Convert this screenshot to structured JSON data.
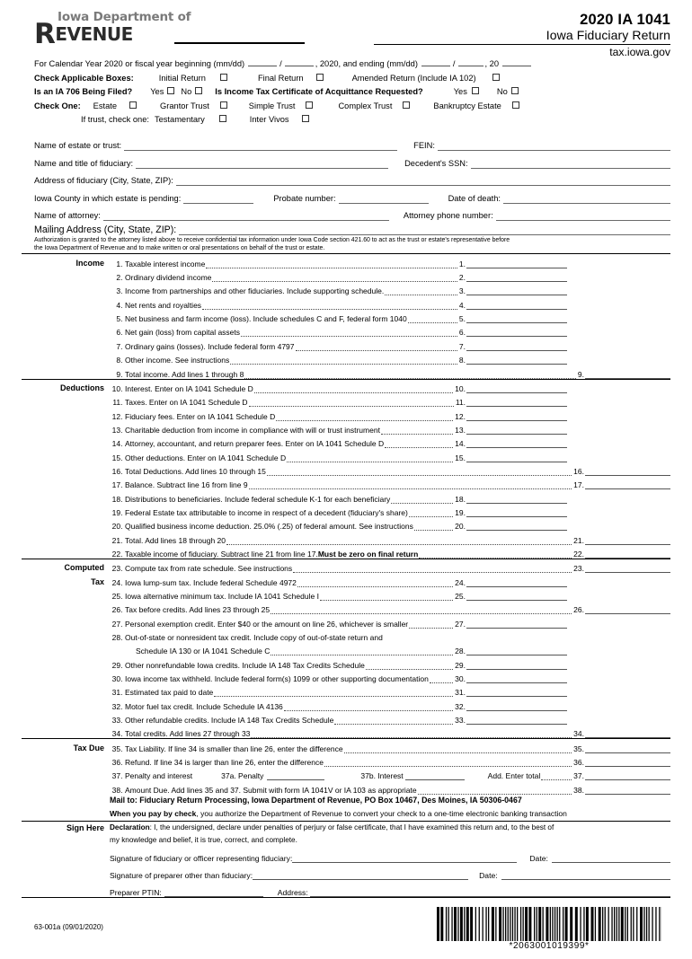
{
  "header": {
    "logo_top": "Iowa Department of",
    "logo_main_drop": "R",
    "logo_main_rest": "EVENUE",
    "title": "2020 IA 1041",
    "subtitle": "Iowa Fiduciary Return",
    "website": "tax.iowa.gov"
  },
  "top": {
    "calendar_year_pre": "For Calendar Year 2020 or fiscal year beginning (mm/dd)",
    "calendar_slash": "/",
    "calendar_mid": ", 2020, and ending (mm/dd)",
    "calendar_slash2": "/",
    "calendar_end": ", 20",
    "check_applicable_label": "Check Applicable Boxes:",
    "initial_return": "Initial Return",
    "final_return": "Final Return",
    "amended_return": "Amended Return (Include IA 102)",
    "ia706_label": "Is an IA 706 Being Filed?",
    "yes": "Yes",
    "no": "No",
    "acquittance_label": "Is Income Tax Certificate of Acquittance Requested?",
    "check_one_label": "Check One:",
    "estate": "Estate",
    "grantor_trust": "Grantor Trust",
    "simple_trust": "Simple Trust",
    "complex_trust": "Complex Trust",
    "bankruptcy_estate": "Bankruptcy Estate",
    "if_trust_label": "If trust, check one:",
    "testamentary": "Testamentary",
    "inter_vivos": "Inter Vivos"
  },
  "fields": {
    "name_of_estate": "Name of estate or trust:",
    "fein": "FEIN:",
    "name_title_fiduciary": "Name and title of fiduciary:",
    "decedent_ssn": "Decedent's SSN:",
    "address_fiduciary": "Address of fiduciary (City, State, ZIP):",
    "iowa_county": "Iowa County in which estate is pending:",
    "probate_number": "Probate number:",
    "date_of_death": "Date of death:",
    "name_attorney": "Name of attorney:",
    "attorney_phone": "Attorney phone number:",
    "mailing_address": "Mailing Address (City, State, ZIP):",
    "authorization_line1": "Authorization is granted to the attorney listed above to receive confidential tax information under Iowa Code section 421.60 to act as the trust or estate's representative before",
    "authorization_line2": "the Iowa Department of Revenue and to make written or oral presentations on behalf of the trust or estate."
  },
  "sections": [
    {
      "label": "Income",
      "lines": [
        {
          "num": "1.",
          "desc": "Taxable interest income",
          "col": "A"
        },
        {
          "num": "2.",
          "desc": "Ordinary dividend income",
          "col": "A"
        },
        {
          "num": "3.",
          "desc": "Income from partnerships and other fiduciaries. Include supporting schedule.",
          "col": "A"
        },
        {
          "num": "4.",
          "desc": "Net rents and royalties",
          "col": "A"
        },
        {
          "num": "5.",
          "desc": "Net business and farm income (loss). Include schedules C and F, federal form 1040",
          "col": "A"
        },
        {
          "num": "6.",
          "desc": "Net gain (loss) from capital assets",
          "col": "A"
        },
        {
          "num": "7.",
          "desc": "Ordinary gains (losses). Include federal form 4797",
          "col": "A"
        },
        {
          "num": "8.",
          "desc": "Other income. See instructions",
          "col": "A"
        },
        {
          "num": "9.",
          "desc": "Total income. Add lines 1 through 8",
          "col": "B"
        }
      ]
    },
    {
      "label": "Deductions",
      "lines": [
        {
          "num": "10.",
          "desc": "Interest. Enter on IA 1041 Schedule D",
          "col": "A"
        },
        {
          "num": "11.",
          "desc": "Taxes. Enter on IA 1041 Schedule D",
          "col": "A"
        },
        {
          "num": "12.",
          "desc": "Fiduciary fees. Enter on IA 1041 Schedule D",
          "col": "A"
        },
        {
          "num": "13.",
          "desc": "Charitable deduction from income in compliance with will or trust instrument",
          "col": "A"
        },
        {
          "num": "14.",
          "desc": "Attorney, accountant, and return preparer fees. Enter on IA 1041 Schedule D",
          "col": "A"
        },
        {
          "num": "15.",
          "desc": "Other deductions. Enter on IA 1041 Schedule D",
          "col": "A"
        },
        {
          "num": "16.",
          "desc": "Total Deductions. Add lines 10 through 15",
          "col": "B"
        },
        {
          "num": "17.",
          "desc": "Balance. Subtract line 16 from line 9",
          "col": "B"
        },
        {
          "num": "18.",
          "desc": "Distributions to beneficiaries. Include federal schedule K-1 for each beneficiary",
          "col": "A"
        },
        {
          "num": "19.",
          "desc": "Federal Estate tax attributable to income in respect of a decedent (fiduciary's share)",
          "col": "A"
        },
        {
          "num": "20.",
          "desc": "Qualified business income deduction. 25.0% (.25) of federal amount. See instructions",
          "col": "A"
        },
        {
          "num": "21.",
          "desc": "Total. Add lines 18 through 20",
          "col": "B"
        },
        {
          "num": "22.",
          "desc": "Taxable income of fiduciary. Subtract line 21 from line 17. ",
          "desc_bold": "Must be zero on final return",
          "col": "B"
        }
      ]
    },
    {
      "label": "Computed",
      "label2": "Tax",
      "lines": [
        {
          "num": "23.",
          "desc": "Compute tax from rate schedule. See instructions",
          "col": "B"
        },
        {
          "num": "24.",
          "desc": "Iowa lump-sum tax. Include federal Schedule 4972",
          "col": "A"
        },
        {
          "num": "25.",
          "desc": "Iowa alternative minimum tax. Include IA 1041 Schedule I",
          "col": "A"
        },
        {
          "num": "26.",
          "desc": "Tax before credits. Add lines 23 through 25",
          "col": "B"
        },
        {
          "num": "27.",
          "desc": "Personal exemption credit. Enter $40 or the amount on line 26, whichever is smaller",
          "col": "A"
        },
        {
          "num": "28.",
          "desc": "Out-of-state or nonresident tax credit. Include copy of out-of-state return and",
          "col": "NONE"
        },
        {
          "num": "",
          "desc": "Schedule IA 130 or IA 1041 Schedule C",
          "col": "A",
          "num2": "28."
        },
        {
          "num": "29.",
          "desc": "Other nonrefundable Iowa credits. Include IA 148 Tax Credits Schedule",
          "col": "A"
        },
        {
          "num": "30.",
          "desc": "Iowa income tax withheld. Include federal form(s) 1099 or other supporting documentation",
          "col": "A"
        },
        {
          "num": "31.",
          "desc": "Estimated tax paid to date",
          "col": "A"
        },
        {
          "num": "32.",
          "desc": "Motor fuel tax credit. Include Schedule IA 4136",
          "col": "A"
        },
        {
          "num": "33.",
          "desc": "Other refundable credits. Include IA 148 Tax Credits Schedule",
          "col": "A"
        },
        {
          "num": "34.",
          "desc": "Total credits. Add lines 27 through 33",
          "col": "B"
        }
      ]
    },
    {
      "label": "Tax Due",
      "lines": [
        {
          "num": "35.",
          "desc": "Tax Liability. If line 34 is smaller than line 26, enter the difference",
          "col": "B"
        },
        {
          "num": "36.",
          "desc": "Refund. If line 34 is larger than line 26, enter the difference",
          "col": "B"
        },
        {
          "num": "38.",
          "desc": "Amount Due. Add lines 35 and 37. Submit with form IA 1041V or IA 103 as appropriate",
          "col": "B"
        }
      ],
      "penalty_line": {
        "num": "37.",
        "desc": "Penalty and interest",
        "sub_a": "37a. Penalty",
        "sub_b": "37b. Interest",
        "add_total": "Add. Enter total",
        "num2": "37."
      },
      "mail_to": "Mail to: Fiduciary Return Processing, Iowa Department of Revenue, PO Box 10467, Des Moines, IA  50306-0467",
      "pay_check_bold": "When you pay by check",
      "pay_check_rest": ", you authorize the Department of Revenue to convert your check to a one-time electronic banking transaction"
    }
  ],
  "sign": {
    "label": "Sign Here",
    "declaration_bold": "Declaration",
    "declaration_line1": ": I, the undersigned, declare under penalties of perjury or false certificate, that I have examined this return and, to the best of",
    "declaration_line2": "my knowledge and belief, it is true, correct, and complete.",
    "sig_fiduciary": "Signature of fiduciary or officer representing fiduciary:",
    "date": "Date:",
    "sig_preparer": "Signature of preparer other than fiduciary:",
    "preparer_ptin": "Preparer PTIN:",
    "address": "Address:"
  },
  "footer": {
    "form_number": "63-001a (09/01/2020)",
    "barcode_text": "*2063001019399*"
  }
}
